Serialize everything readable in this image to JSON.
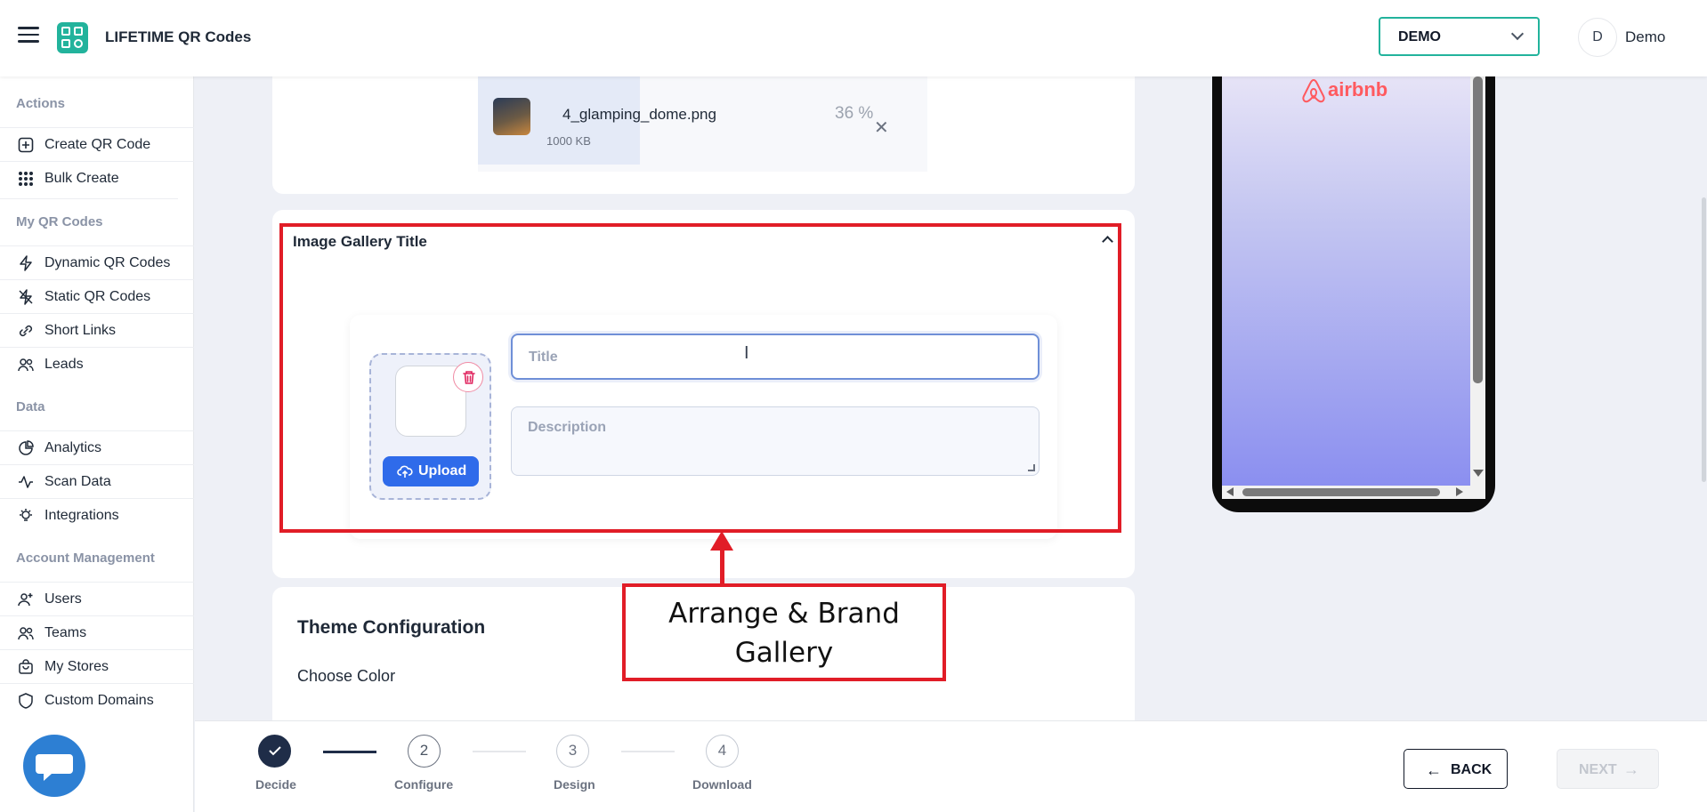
{
  "header": {
    "app_title": "LIFETIME QR Codes",
    "workspace": "DEMO",
    "user_initial": "D",
    "user_name": "Demo"
  },
  "sidebar": {
    "sections": [
      {
        "title": "Actions",
        "items": [
          {
            "label": "Create QR Code",
            "icon": "plus-square-icon"
          },
          {
            "label": "Bulk Create",
            "icon": "grid-dots-icon"
          }
        ]
      },
      {
        "title": "My QR Codes",
        "items": [
          {
            "label": "Dynamic QR Codes",
            "icon": "lightning-icon"
          },
          {
            "label": "Static QR Codes",
            "icon": "lightning-off-icon"
          },
          {
            "label": "Short Links",
            "icon": "link-icon"
          },
          {
            "label": "Leads",
            "icon": "people-icon"
          }
        ]
      },
      {
        "title": "Data",
        "items": [
          {
            "label": "Analytics",
            "icon": "pie-chart-icon"
          },
          {
            "label": "Scan Data",
            "icon": "activity-icon"
          },
          {
            "label": "Integrations",
            "icon": "bulb-icon"
          }
        ]
      },
      {
        "title": "Account Management",
        "items": [
          {
            "label": "Users",
            "icon": "user-plus-icon"
          },
          {
            "label": "Teams",
            "icon": "team-icon"
          },
          {
            "label": "My Stores",
            "icon": "bag-icon"
          },
          {
            "label": "Custom Domains",
            "icon": "shield-icon"
          }
        ]
      }
    ]
  },
  "upload_file": {
    "name": "4_glamping_dome.png",
    "size": "1000 KB",
    "progress_label": "36 %",
    "progress": 36
  },
  "gallery": {
    "title": "Image Gallery Title",
    "upload_label": "Upload",
    "title_placeholder": "Title",
    "description_placeholder": "Description"
  },
  "annotation": {
    "line1": "Arrange & Brand",
    "line2": "Gallery"
  },
  "theme": {
    "title": "Theme Configuration",
    "choose_color": "Choose Color"
  },
  "preview": {
    "brand": "airbnb",
    "brand_color": "#ff5a5f"
  },
  "steps": [
    {
      "number": "1",
      "label": "Decide",
      "state": "done"
    },
    {
      "number": "2",
      "label": "Configure",
      "state": "active"
    },
    {
      "number": "3",
      "label": "Design",
      "state": "pending"
    },
    {
      "number": "4",
      "label": "Download",
      "state": "pending"
    }
  ],
  "footer": {
    "back_label": "BACK",
    "next_label": "NEXT"
  },
  "colors": {
    "accent": "#22b39c",
    "primary_button": "#2f6bea",
    "annotation": "#e11d27"
  }
}
